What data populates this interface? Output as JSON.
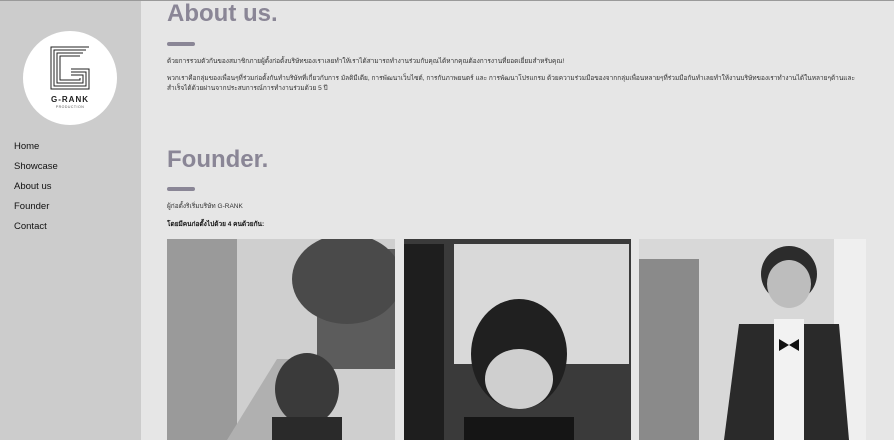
{
  "logo": {
    "name": "G-RANK",
    "subtitle": "PRODUCTION"
  },
  "nav": {
    "items": [
      {
        "label": "Home"
      },
      {
        "label": "Showcase"
      },
      {
        "label": "About us"
      },
      {
        "label": "Founder"
      },
      {
        "label": "Contact"
      }
    ]
  },
  "about": {
    "title": "About us.",
    "paragraph1": "ด้วยการรวมตัวกันของสมาชิกภายผู้ตั้งก่อตั้งบริษัทของเราเลยทำให้เราได้สามารถทำงานร่วมกับคุณได้หากคุณต้องการงานที่ยอดเยี่ยมสำหรับคุณ!",
    "paragraph2": "พวกเราคือกลุ่มของเพื่อนๆที่ร่วมก่อตั้งกันทำบริษัทที่เกี่ยวกับการ มัลติมีเดีย, การพัฒนาเว็บไซต์, การกับภาพยนตร์ และ การพัฒนาโปรแกรม ด้วยความร่วมมือของจากกลุ่มเพื่อนหลายๆที่ร่วมมือกันทำเลยทำให้งานบริษัทของเราทำงานได้ในหลายๆด้านและสำเร็จได้ด้วยผ่านจากประสบการณ์การทำงานร่วมด้วย 5 ปี"
  },
  "founder": {
    "title": "Founder.",
    "line1": "ผู้ก่อตั้งริเริ่มบริษัท G-RANK",
    "line2": "โดยมีคนก่อตั้งไปด้วย 4 คนด้วยกัน:"
  },
  "photos": [
    {
      "icon": "founder-photo-1"
    },
    {
      "icon": "founder-photo-2"
    },
    {
      "icon": "founder-photo-3"
    }
  ]
}
